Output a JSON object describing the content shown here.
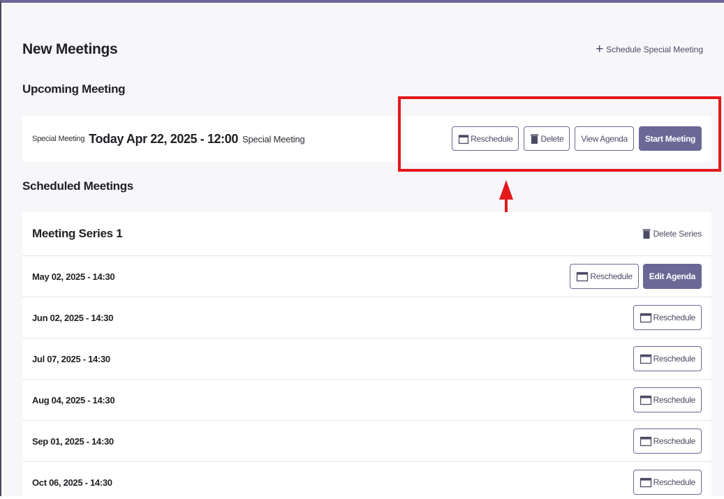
{
  "header": {
    "title": "New Meetings",
    "schedule_special_label": "Schedule Special Meeting"
  },
  "upcoming": {
    "section_title": "Upcoming Meeting",
    "type": "Special Meeting",
    "date": "Today Apr 22, 2025 - 12:00",
    "name": "Special Meeting",
    "actions": {
      "reschedule": "Reschedule",
      "delete": "Delete",
      "view_agenda": "View Agenda",
      "start": "Start Meeting"
    }
  },
  "scheduled": {
    "section_title": "Scheduled Meetings",
    "series": {
      "title": "Meeting Series 1",
      "delete_label": "Delete Series",
      "reschedule_label": "Reschedule",
      "edit_agenda_label": "Edit Agenda",
      "meetings": [
        {
          "date": "May 02, 2025 - 14:30"
        },
        {
          "date": "Jun 02, 2025 - 14:30"
        },
        {
          "date": "Jul 07, 2025 - 14:30"
        },
        {
          "date": "Aug 04, 2025 - 14:30"
        },
        {
          "date": "Sep 01, 2025 - 14:30"
        },
        {
          "date": "Oct 06, 2025 - 14:30"
        }
      ]
    }
  },
  "colors": {
    "accent": "#6b6896",
    "annotation": "#e3191c",
    "background": "#f7f6f9"
  },
  "icons": {
    "add": "plus-icon",
    "calendar": "calendar-icon",
    "delete": "trash-icon"
  }
}
